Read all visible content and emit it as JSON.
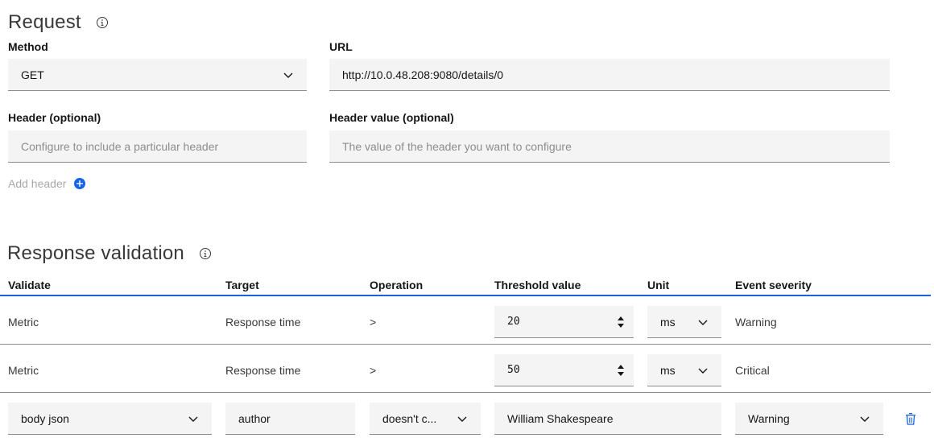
{
  "request": {
    "title": "Request",
    "method_label": "Method",
    "method_value": "GET",
    "url_label": "URL",
    "url_value": "http://10.0.48.208:9080/details/0",
    "header_label": "Header (optional)",
    "header_placeholder": "Configure to include a particular header",
    "header_value_label": "Header value (optional)",
    "header_value_placeholder": "The value of the header you want to configure",
    "add_header_label": "Add header"
  },
  "validation": {
    "title": "Response validation",
    "columns": [
      "Validate",
      "Target",
      "Operation",
      "Threshold value",
      "Unit",
      "Event severity"
    ],
    "rows": [
      {
        "validate": "Metric",
        "target": "Response time",
        "operation": ">",
        "threshold": "20",
        "unit": "ms",
        "severity": "Warning"
      },
      {
        "validate": "Metric",
        "target": "Response time",
        "operation": ">",
        "threshold": "50",
        "unit": "ms",
        "severity": "Critical"
      },
      {
        "validate": "body json",
        "target": "author",
        "operation": "doesn't c...",
        "threshold": "William Shakespeare",
        "severity": "Warning"
      }
    ]
  },
  "colors": {
    "accent": "#0f62fe",
    "field_bg": "#f4f4f4",
    "border": "#8d8d8d"
  }
}
